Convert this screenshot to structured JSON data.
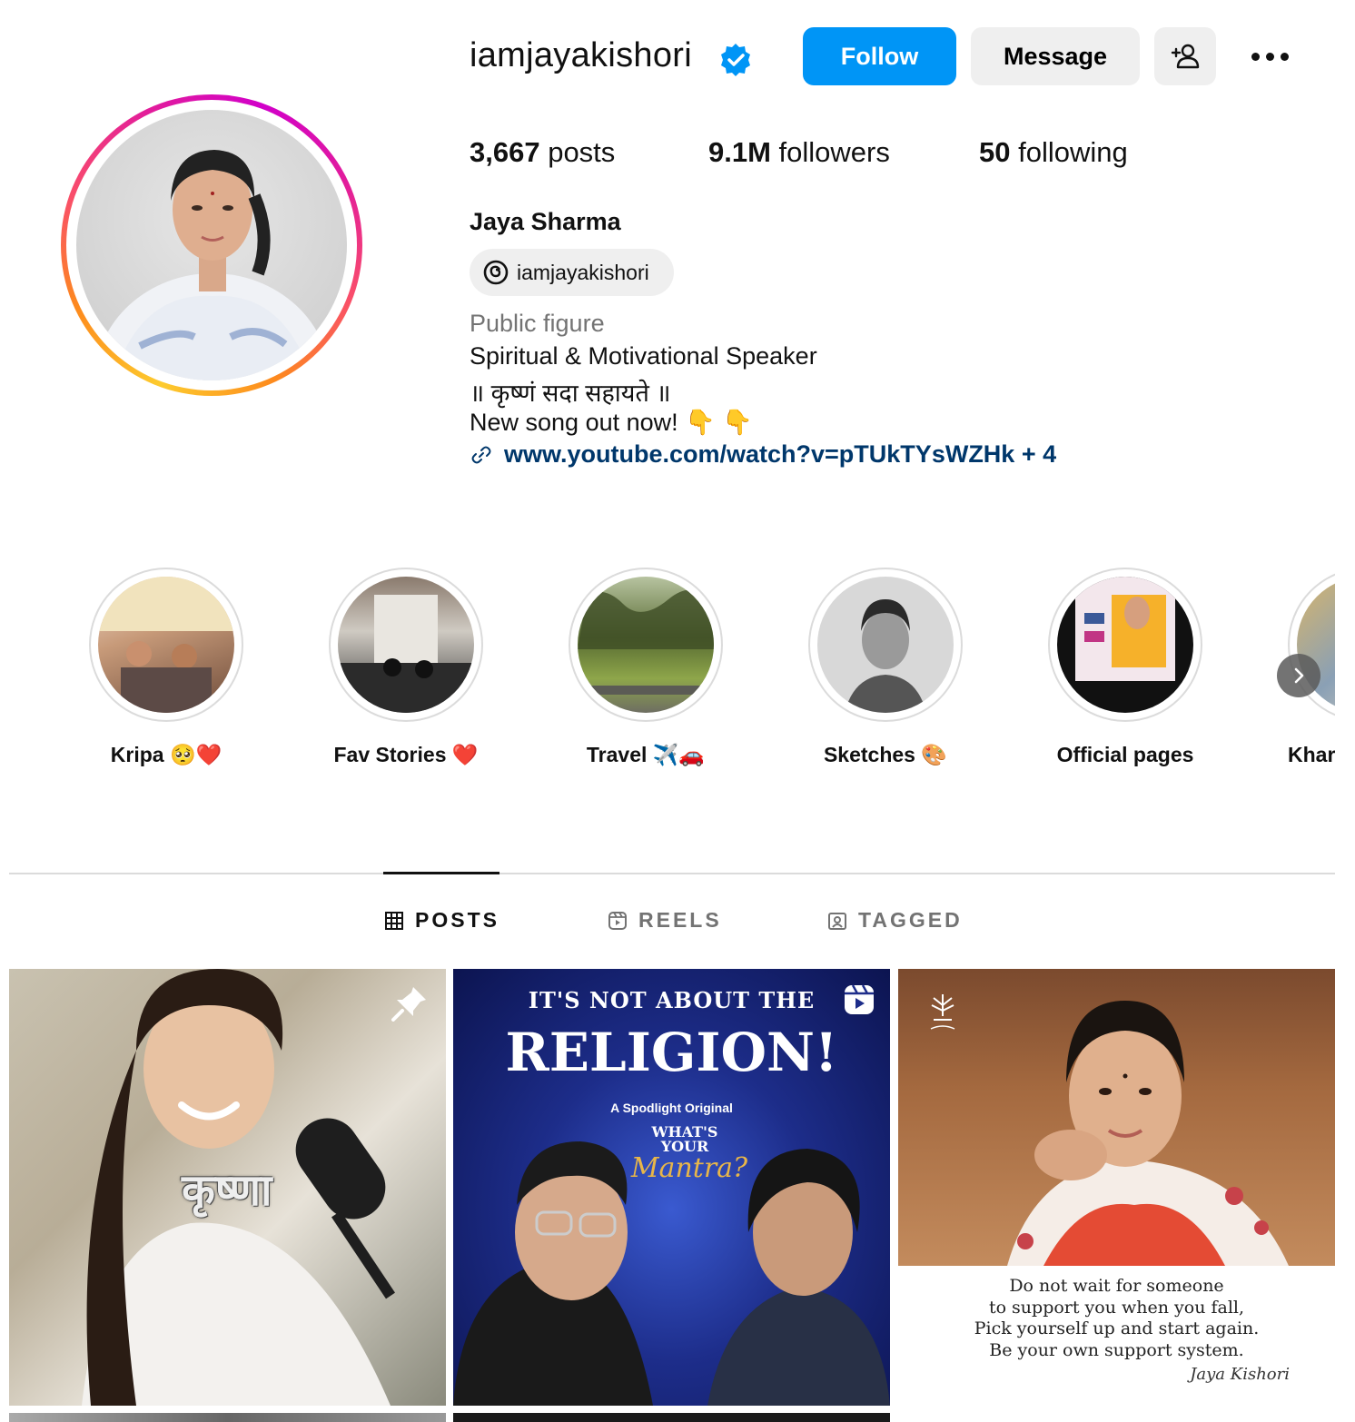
{
  "profile": {
    "username": "iamjayakishori",
    "verified": true,
    "follow_label": "Follow",
    "message_label": "Message",
    "posts_count": "3,667",
    "posts_label": "posts",
    "followers_count": "9.1M",
    "followers_label": "followers",
    "following_count": "50",
    "following_label": "following",
    "full_name": "Jaya Sharma",
    "threads_handle": "iamjayakishori",
    "category": "Public figure",
    "bio_lines": [
      "Spiritual & Motivational Speaker",
      "॥ कृष्णं सदा सहायते ॥",
      "New song out now! 👇 👇"
    ],
    "link": "www.youtube.com/watch?v=pTUkTYsWZHk + 4"
  },
  "highlights": [
    {
      "label": "Kripa 🥺❤️"
    },
    {
      "label": "Fav Stories ❤️"
    },
    {
      "label": "Travel ✈️🚗"
    },
    {
      "label": "Sketches 🎨"
    },
    {
      "label": "Official pages"
    },
    {
      "label": "Khar"
    }
  ],
  "tabs": [
    {
      "label": "POSTS",
      "active": true
    },
    {
      "label": "REELS",
      "active": false
    },
    {
      "label": "TAGGED",
      "active": false
    }
  ],
  "posts": [
    {
      "overlay_text": "कृष्णा",
      "pinned": true
    },
    {
      "reel": true,
      "headline_top": "IT'S NOT ABOUT THE",
      "headline_big": "RELIGION!",
      "subtitle": "A Spodlight Original",
      "show_line1": "WHAT'S",
      "show_line2": "YOUR",
      "show_title": "Mantra?"
    },
    {
      "quote_lines": [
        "Do not wait for someone",
        "to support you when you fall,",
        "Pick yourself up and start again.",
        "Be your own support system."
      ],
      "signature": "Jaya Kishori"
    }
  ],
  "colors": {
    "follow_button": "#0095f6",
    "link": "#00376b",
    "secondary_text": "#737373",
    "button_grey": "#efefef"
  }
}
